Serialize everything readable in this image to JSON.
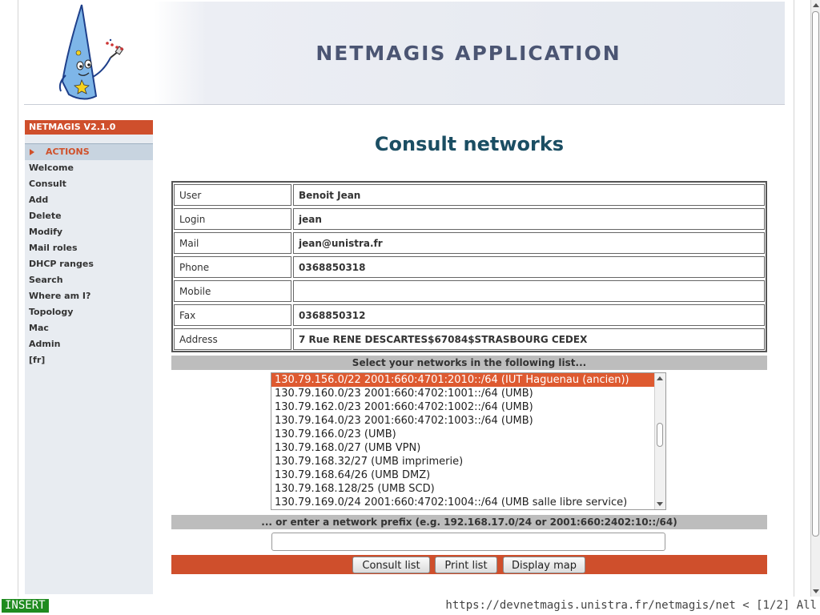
{
  "app": {
    "title": "NETMAGIS APPLICATION",
    "version": "NETMAGIS V2.1.0",
    "accent_color": "#cf4f2c"
  },
  "sidebar": {
    "section_label": "ACTIONS",
    "items": [
      "Welcome",
      "Consult",
      "Add",
      "Delete",
      "Modify",
      "Mail roles",
      "DHCP ranges",
      "Search",
      "Where am I?",
      "Topology",
      "Mac",
      "Admin",
      "[fr]"
    ]
  },
  "main": {
    "title": "Consult networks",
    "user_info": [
      {
        "label": "User",
        "value": "Benoit Jean"
      },
      {
        "label": "Login",
        "value": "jean"
      },
      {
        "label": "Mail",
        "value": "jean@unistra.fr"
      },
      {
        "label": "Phone",
        "value": "0368850318"
      },
      {
        "label": "Mobile",
        "value": ""
      },
      {
        "label": "Fax",
        "value": "0368850312"
      },
      {
        "label": "Address",
        "value": "7 Rue RENE DESCARTES$67084$STRASBOURG CEDEX"
      }
    ],
    "select_header": "Select your networks in the following list...",
    "networks": [
      "130.79.156.0/22 2001:660:4701:2010::/64 (IUT Haguenau (ancien))",
      "130.79.160.0/23 2001:660:4702:1001::/64 (UMB)",
      "130.79.162.0/23 2001:660:4702:1002::/64 (UMB)",
      "130.79.164.0/23 2001:660:4702:1003::/64 (UMB)",
      "130.79.166.0/23 (UMB)",
      "130.79.168.0/27 (UMB VPN)",
      "130.79.168.32/27 (UMB imprimerie)",
      "130.79.168.64/26 (UMB DMZ)",
      "130.79.168.128/25 (UMB SCD)",
      "130.79.169.0/24 2001:660:4702:1004::/64 (UMB salle libre service)"
    ],
    "selected_network_index": 0,
    "prefix_header": "... or enter a network prefix (e.g. 192.168.17.0/24 or 2001:660:2402:10::/64)",
    "prefix_value": "",
    "buttons": {
      "consult": "Consult list",
      "print": "Print list",
      "map": "Display map"
    }
  },
  "status_bar": {
    "mode": "INSERT",
    "url_line": "https://devnetmagis.unistra.fr/netmagis/net < [1/2] All"
  }
}
